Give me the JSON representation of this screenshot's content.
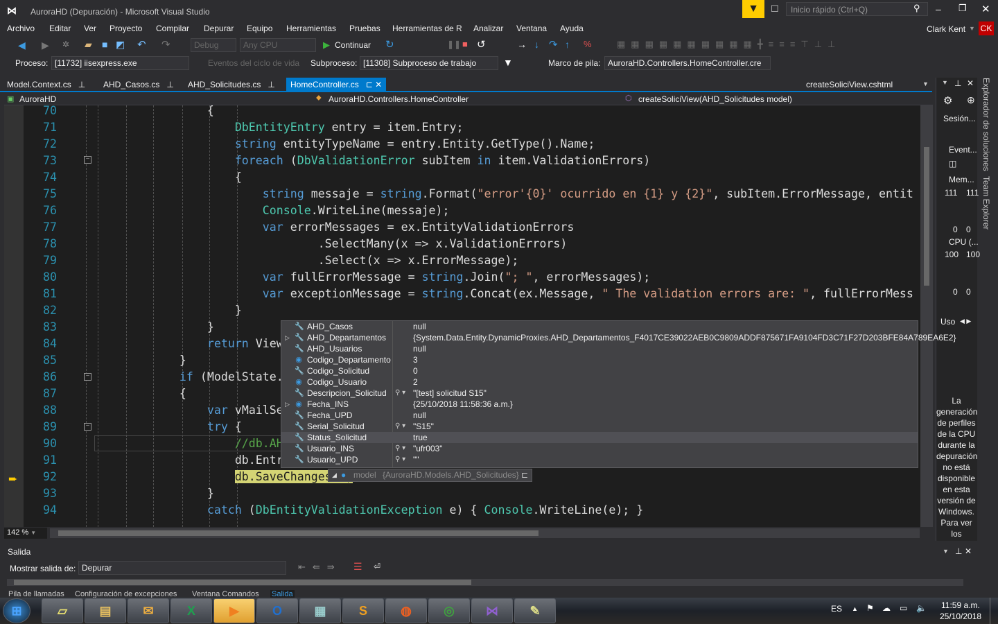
{
  "window": {
    "title": "AuroraHD (Depuración) - Microsoft Visual Studio",
    "quick_launch_placeholder": "Inicio rápido (Ctrl+Q)",
    "user": "Clark Kent",
    "user_initials": "CK"
  },
  "menu": [
    "Archivo",
    "Editar",
    "Ver",
    "Proyecto",
    "Compilar",
    "Depurar",
    "Equipo",
    "Herramientas",
    "Pruebas",
    "Herramientas de R",
    "Analizar",
    "Ventana",
    "Ayuda"
  ],
  "toolbar": {
    "config": "Debug",
    "platform": "Any CPU",
    "continue": "Continuar"
  },
  "debug_bar": {
    "process_label": "Proceso:",
    "process": "[11732] iisexpress.exe",
    "lifecycle": "Eventos del ciclo de vida",
    "thread_label": "Subproceso:",
    "thread": "[11308] Subproceso de trabajo",
    "frame_label": "Marco de pila:",
    "frame": "AuroraHD.Controllers.HomeController.cre"
  },
  "tabs": [
    {
      "label": "Model.Context.cs",
      "active": false
    },
    {
      "label": "AHD_Casos.cs",
      "active": false
    },
    {
      "label": "AHD_Solicitudes.cs",
      "active": false
    },
    {
      "label": "HomeController.cs",
      "active": true
    }
  ],
  "preview_tab": "createSoliciView.cshtml",
  "nav": {
    "project": "AuroraHD",
    "class": "AuroraHD.Controllers.HomeController",
    "member": "createSoliciView(AHD_Solicitudes model)"
  },
  "code": [
    {
      "n": "70",
      "t": [
        [
          "                ",
          "tx"
        ],
        [
          "{",
          "tx"
        ]
      ]
    },
    {
      "n": "71",
      "t": [
        [
          "                    ",
          "tx"
        ],
        [
          "DbEntityEntry",
          "ty"
        ],
        [
          " entry = item.Entry;",
          "tx"
        ]
      ]
    },
    {
      "n": "72",
      "t": [
        [
          "                    ",
          "tx"
        ],
        [
          "string",
          "kw"
        ],
        [
          " entityTypeName = entry.Entity.GetType().Name;",
          "tx"
        ]
      ]
    },
    {
      "n": "73",
      "t": [
        [
          "                    ",
          "tx"
        ],
        [
          "foreach",
          "kw"
        ],
        [
          " (",
          "tx"
        ],
        [
          "DbValidationError",
          "ty"
        ],
        [
          " subItem ",
          "tx"
        ],
        [
          "in",
          "kw"
        ],
        [
          " item.ValidationErrors)",
          "tx"
        ]
      ]
    },
    {
      "n": "74",
      "t": [
        [
          "                    ",
          "tx"
        ],
        [
          "{",
          "tx"
        ]
      ]
    },
    {
      "n": "75",
      "t": [
        [
          "                        ",
          "tx"
        ],
        [
          "string",
          "kw"
        ],
        [
          " messaje = ",
          "tx"
        ],
        [
          "string",
          "kw"
        ],
        [
          ".Format(",
          "tx"
        ],
        [
          "\"error'{0}' ocurrido en {1} y {2}\"",
          "st"
        ],
        [
          ", subItem.ErrorMessage, entit",
          "tx"
        ]
      ]
    },
    {
      "n": "76",
      "t": [
        [
          "                        ",
          "tx"
        ],
        [
          "Console",
          "ty"
        ],
        [
          ".WriteLine(messaje);",
          "tx"
        ]
      ]
    },
    {
      "n": "77",
      "t": [
        [
          "                        ",
          "tx"
        ],
        [
          "var",
          "kw"
        ],
        [
          " errorMessages = ex.EntityValidationErrors",
          "tx"
        ]
      ]
    },
    {
      "n": "78",
      "t": [
        [
          "                                .SelectMany(x => x.ValidationErrors)",
          "tx"
        ]
      ]
    },
    {
      "n": "79",
      "t": [
        [
          "                                .Select(x => x.ErrorMessage);",
          "tx"
        ]
      ]
    },
    {
      "n": "80",
      "t": [
        [
          "                        ",
          "tx"
        ],
        [
          "var",
          "kw"
        ],
        [
          " fullErrorMessage = ",
          "tx"
        ],
        [
          "string",
          "kw"
        ],
        [
          ".Join(",
          "tx"
        ],
        [
          "\"; \"",
          "st"
        ],
        [
          ", errorMessages);",
          "tx"
        ]
      ]
    },
    {
      "n": "81",
      "t": [
        [
          "                        ",
          "tx"
        ],
        [
          "var",
          "kw"
        ],
        [
          " exceptionMessage = ",
          "tx"
        ],
        [
          "string",
          "kw"
        ],
        [
          ".Concat(ex.Message, ",
          "tx"
        ],
        [
          "\" The validation errors are: \"",
          "st"
        ],
        [
          ", fullErrorMess",
          "tx"
        ]
      ]
    },
    {
      "n": "82",
      "t": [
        [
          "                    ",
          "tx"
        ],
        [
          "}",
          "tx"
        ]
      ]
    },
    {
      "n": "83",
      "t": [
        [
          "                ",
          "tx"
        ],
        [
          "}",
          "tx"
        ]
      ]
    },
    {
      "n": "84",
      "t": [
        [
          "                ",
          "tx"
        ],
        [
          "return",
          "kw"
        ],
        [
          " View",
          "tx"
        ]
      ]
    },
    {
      "n": "85",
      "t": [
        [
          "            ",
          "tx"
        ],
        [
          "}",
          "tx"
        ]
      ]
    },
    {
      "n": "86",
      "t": [
        [
          "            ",
          "tx"
        ],
        [
          "if",
          "kw"
        ],
        [
          " (ModelState.",
          "tx"
        ]
      ]
    },
    {
      "n": "87",
      "t": [
        [
          "            ",
          "tx"
        ],
        [
          "{",
          "tx"
        ]
      ]
    },
    {
      "n": "88",
      "t": [
        [
          "                ",
          "tx"
        ],
        [
          "var",
          "kw"
        ],
        [
          " vMailSe",
          "tx"
        ]
      ]
    },
    {
      "n": "89",
      "t": [
        [
          "                ",
          "tx"
        ],
        [
          "try",
          "kw"
        ],
        [
          " {",
          "tx"
        ]
      ]
    },
    {
      "n": "90",
      "t": [
        [
          "                    ",
          "tx"
        ],
        [
          "//db.AH",
          "cm"
        ]
      ]
    },
    {
      "n": "91",
      "t": [
        [
          "                    ",
          "tx"
        ],
        [
          "db.Entr",
          "tx"
        ]
      ]
    },
    {
      "n": "92",
      "t": [
        [
          "                    ",
          "tx"
        ],
        [
          "db.SaveChanges();",
          "hl"
        ]
      ]
    },
    {
      "n": "93",
      "t": [
        [
          "                ",
          "tx"
        ],
        [
          "}",
          "tx"
        ]
      ]
    },
    {
      "n": "94",
      "t": [
        [
          "                ",
          "tx"
        ],
        [
          "catch",
          "kw"
        ],
        [
          " (",
          "tx"
        ],
        [
          "DbEntityValidationException",
          "ty"
        ],
        [
          " e) { ",
          "tx"
        ],
        [
          "Console",
          "ty"
        ],
        [
          ".WriteLine(e); }",
          "tx"
        ]
      ]
    }
  ],
  "current_line": "92",
  "datatip": {
    "rows": [
      {
        "name": "AHD_Casos",
        "value": "null",
        "icon": "wrench-icon",
        "expand": false,
        "visualizer": false
      },
      {
        "name": "AHD_Departamentos",
        "value": "{System.Data.Entity.DynamicProxies.AHD_Departamentos_F4017CE39022AEB0C9809ADDF875671FA9104FD3C71F27D203BFE84A789EA6E2}",
        "icon": "wrench-icon",
        "expand": true,
        "visualizer": false
      },
      {
        "name": "AHD_Usuarios",
        "value": "null",
        "icon": "wrench-icon",
        "expand": false,
        "visualizer": false
      },
      {
        "name": "Codigo_Departamento",
        "value": "3",
        "icon": "field-icon",
        "expand": false,
        "visualizer": false
      },
      {
        "name": "Codigo_Solicitud",
        "value": "0",
        "icon": "wrench-icon",
        "expand": false,
        "visualizer": false
      },
      {
        "name": "Codigo_Usuario",
        "value": "2",
        "icon": "field-icon",
        "expand": false,
        "visualizer": false
      },
      {
        "name": "Descripcion_Solicitud",
        "value": "\"[test] solicitud S15\"",
        "icon": "wrench-icon",
        "expand": false,
        "visualizer": true
      },
      {
        "name": "Fecha_INS",
        "value": "{25/10/2018 11:58:36 a.m.}",
        "icon": "field-icon",
        "expand": true,
        "visualizer": false
      },
      {
        "name": "Fecha_UPD",
        "value": "null",
        "icon": "wrench-icon",
        "expand": false,
        "visualizer": false
      },
      {
        "name": "Serial_Solicitud",
        "value": "\"S15\"",
        "icon": "wrench-icon",
        "expand": false,
        "visualizer": true
      },
      {
        "name": "Status_Solicitud",
        "value": "true",
        "icon": "wrench-icon",
        "expand": false,
        "visualizer": false,
        "selected": true
      },
      {
        "name": "Usuario_INS",
        "value": "\"ufr003\"",
        "icon": "wrench-icon",
        "expand": false,
        "visualizer": true
      },
      {
        "name": "Usuario_UPD",
        "value": "\"\"",
        "icon": "wrench-icon",
        "expand": false,
        "visualizer": true
      }
    ],
    "root_name": "model",
    "root_value": "{AuroraHD.Models.AHD_Solicitudes}"
  },
  "zoom": "142 %",
  "diagnostics": {
    "session": "Sesión...",
    "events": "Event...",
    "memory": "Mem...",
    "mem_max": "111",
    "mem_max2": "111",
    "mem_min": "0",
    "cpu": "CPU (...",
    "cpu_max": "100",
    "cpu_max2": "100",
    "cpu_min": "0",
    "usage": "Uso",
    "message": "La generación de perfiles de la CPU durante la depuración no está disponible en esta versión de Windows. Para ver los"
  },
  "side_tabs": [
    "Explorador de soluciones",
    "Team Explorer"
  ],
  "output": {
    "title": "Salida",
    "show_label": "Mostrar salida de:",
    "source": "Depurar"
  },
  "bottom_tabs": [
    {
      "label": "Pila de llamadas",
      "active": false
    },
    {
      "label": "Configuración de excepciones",
      "active": false
    },
    {
      "label": "Ventana Comandos",
      "active": false
    },
    {
      "label": "Salida",
      "active": true
    }
  ],
  "taskbar": {
    "apps": [
      "start",
      "sticky-notes",
      "explorer",
      "outlook-old",
      "excel",
      "media-player",
      "outlook",
      "calculator",
      "sublime",
      "firefox",
      "chrome",
      "visual-studio",
      "tools"
    ],
    "lang": "ES",
    "time": "11:59 a.m.",
    "date": "25/10/2018"
  },
  "colors": {
    "accent": "#007acc",
    "keyword": "#569cd6",
    "type": "#4ec9b0",
    "string": "#d69d85",
    "comment": "#57a64a",
    "line_number": "#2b91af",
    "breakpoint_highlight": "#d4d474",
    "notification": "#ffcc00",
    "user_badge": "#c00000"
  }
}
